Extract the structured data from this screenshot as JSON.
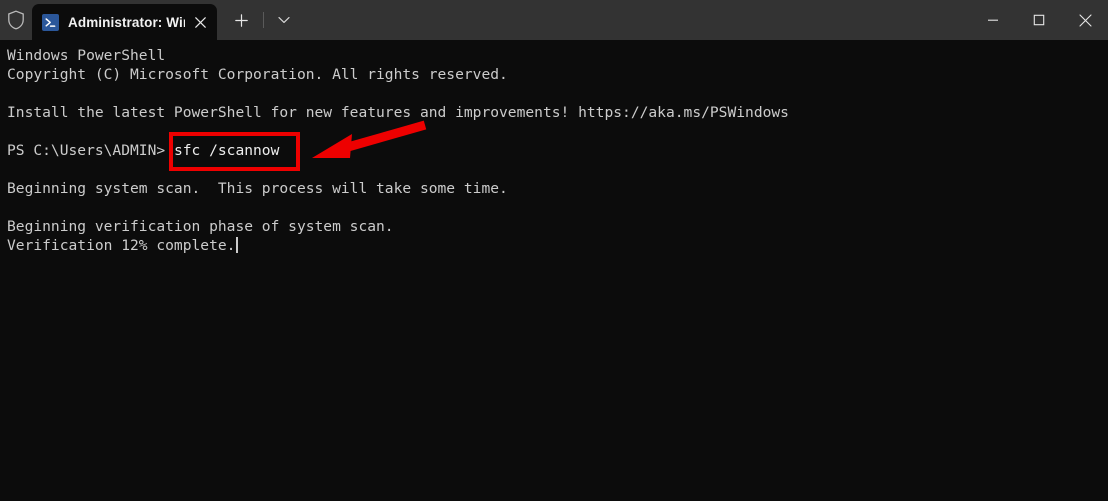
{
  "window": {
    "shield_icon": "shield-icon",
    "controls": {
      "minimize_label": "Minimize",
      "maximize_label": "Maximize",
      "close_label": "Close"
    }
  },
  "tabstrip": {
    "active_tab": {
      "icon": "powershell-icon",
      "title": "Administrator: Windows Powe",
      "close_label": "Close tab"
    },
    "new_tab_label": "New tab",
    "dropdown_label": "Open a new tab dropdown"
  },
  "terminal": {
    "background": "#0c0c0c",
    "foreground": "#cccccc",
    "lines": [
      "Windows PowerShell",
      "Copyright (C) Microsoft Corporation. All rights reserved.",
      "",
      "Install the latest PowerShell for new features and improvements! https://aka.ms/PSWindows",
      ""
    ],
    "prompt": "PS C:\\Users\\ADMIN> ",
    "command": "sfc /scannow",
    "output_lines": [
      "",
      "Beginning system scan.  This process will take some time.",
      "",
      "Beginning verification phase of system scan.",
      "Verification 12% complete."
    ],
    "cursor_visible": true
  },
  "annotations": {
    "highlight_color": "#ee0000",
    "box_target": "sfc /scannow",
    "arrow_direction": "points-left-to-command"
  }
}
